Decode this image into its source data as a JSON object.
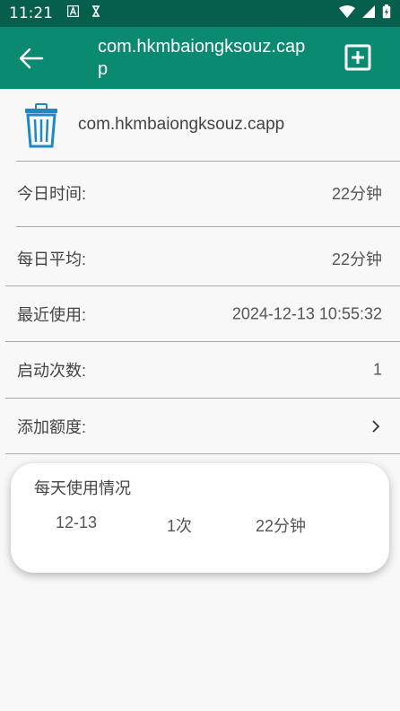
{
  "status_bar": {
    "time": "11:21",
    "left_icons": [
      "a-notification-icon",
      "hourglass-icon"
    ],
    "right_icons": [
      "wifi-icon",
      "signal-icon",
      "battery-charging-icon"
    ]
  },
  "app_bar": {
    "title": "com.hkmbaiongksouz.capp",
    "back_icon": "arrow-left-icon",
    "action_icon": "add-box-icon",
    "background_color": "#0b8a72",
    "status_color": "#065f4c"
  },
  "app_info": {
    "icon": "trash-icon",
    "icon_color": "#1e88c8",
    "package_name": "com.hkmbaiongksouz.capp"
  },
  "details": [
    {
      "label": "今日时间:",
      "value": "22分钟"
    },
    {
      "label": "每日平均:",
      "value": "22分钟"
    },
    {
      "label": "最近使用:",
      "value": "2024-12-13 10:55:32"
    },
    {
      "label": "启动次数:",
      "value": "1"
    },
    {
      "label": "添加额度:",
      "value": ""
    }
  ],
  "daily_usage": {
    "title": "每天使用情况",
    "rows": [
      {
        "date": "12-13",
        "count": "1次",
        "duration": "22分钟"
      }
    ]
  }
}
